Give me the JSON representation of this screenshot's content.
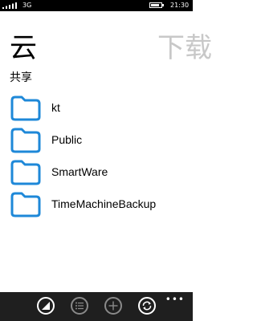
{
  "status_bar": {
    "network": "3G",
    "time": "21:30",
    "battery_level": 0.8
  },
  "pivot": {
    "current_title": "云",
    "next_title": "下载",
    "subtitle": "共享"
  },
  "folders": [
    {
      "name": "kt"
    },
    {
      "name": "Public"
    },
    {
      "name": "SmartWare"
    },
    {
      "name": "TimeMachineBackup"
    }
  ],
  "app_bar": {
    "buttons": [
      {
        "icon": "select-icon",
        "enabled": true
      },
      {
        "icon": "list-icon",
        "enabled": false
      },
      {
        "icon": "add-icon",
        "enabled": false
      },
      {
        "icon": "sync-icon",
        "enabled": true
      }
    ],
    "more_label": "•••"
  },
  "colors": {
    "folder_blue": "#1e88d8",
    "app_bar": "#1f1f1f",
    "dim": "#8a8a8a"
  }
}
